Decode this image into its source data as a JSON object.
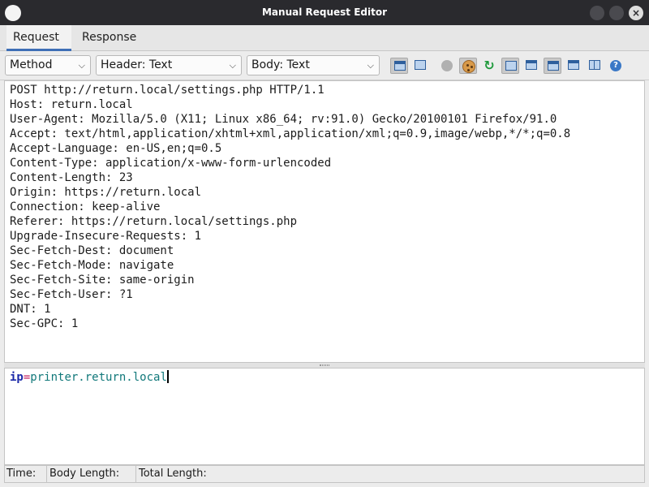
{
  "window": {
    "title": "Manual Request Editor",
    "close_glyph": "×"
  },
  "tabs": [
    {
      "label": "Request",
      "active": true
    },
    {
      "label": "Response",
      "active": false
    }
  ],
  "toolbar": {
    "method_select": "Method",
    "header_select": "Header: Text",
    "body_select": "Body: Text",
    "chevron_glyph": "⌵",
    "redo_glyph": "↻",
    "help_glyph": "?",
    "icons": [
      "layout-split-icon",
      "layout-single-icon",
      "stop-icon",
      "cookie-icon",
      "follow-redirect-icon",
      "fullscreen-icon",
      "refresh-request-icon",
      "headers-panel-icon",
      "split-horizontal-icon",
      "split-vertical-icon",
      "help-icon"
    ]
  },
  "request": {
    "header_lines": [
      "POST http://return.local/settings.php HTTP/1.1",
      "Host: return.local",
      "User-Agent: Mozilla/5.0 (X11; Linux x86_64; rv:91.0) Gecko/20100101 Firefox/91.0",
      "Accept: text/html,application/xhtml+xml,application/xml;q=0.9,image/webp,*/*;q=0.8",
      "Accept-Language: en-US,en;q=0.5",
      "Content-Type: application/x-www-form-urlencoded",
      "Content-Length: 23",
      "Origin: https://return.local",
      "Connection: keep-alive",
      "Referer: https://return.local/settings.php",
      "Upgrade-Insecure-Requests: 1",
      "Sec-Fetch-Dest: document",
      "Sec-Fetch-Mode: navigate",
      "Sec-Fetch-Site: same-origin",
      "Sec-Fetch-User: ?1",
      "DNT: 1",
      "Sec-GPC: 1"
    ],
    "body": {
      "key": "ip",
      "eq": "=",
      "value": "printer.return.local"
    }
  },
  "status": {
    "time": "Time:",
    "body_length": "Body Length:",
    "total_length": "Total Length:"
  }
}
